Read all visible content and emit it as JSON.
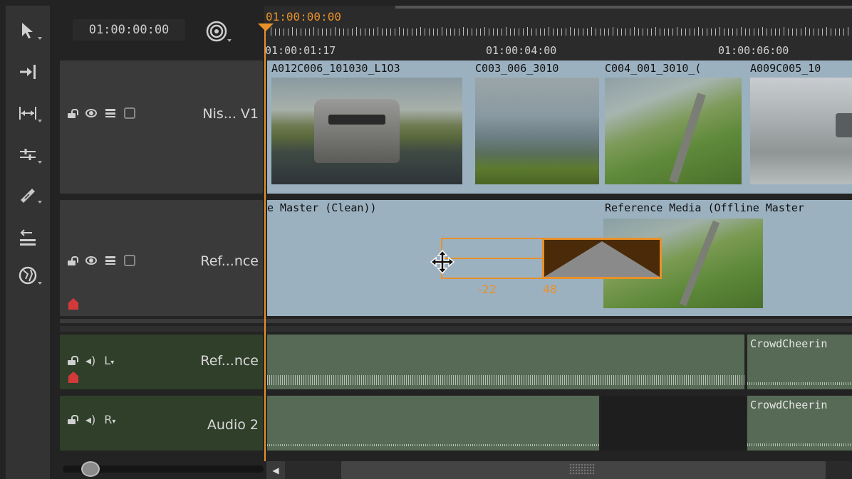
{
  "toolbar": {
    "tools": [
      "select-tool",
      "track-select-tool",
      "slip-tool",
      "razor-tool",
      "multi-tool",
      "nudge-tool",
      "snap-tool"
    ]
  },
  "header": {
    "timecode": "01:00:00:00",
    "snap_icon": "target-icon"
  },
  "ruler": {
    "playhead_time": "01:00:00:00",
    "labels": [
      "01:00:01:17",
      "01:00:04:00",
      "01:00:06:00"
    ]
  },
  "tracks": {
    "video_1": {
      "name": "Nis... V1",
      "clips": [
        {
          "label": "A012C006_101030_L1O3"
        },
        {
          "label": "C003_006_3010"
        },
        {
          "label": "C004_001_3010_("
        },
        {
          "label": "A009C005_10"
        }
      ]
    },
    "video_2": {
      "name": "Ref...nce",
      "clips": [
        {
          "label": "e Master (Clean))"
        },
        {
          "label": "Reference Media (Offline Master"
        }
      ]
    },
    "audio_1": {
      "name": "Ref...nce",
      "channel": "L",
      "clips": [
        {
          "label": ""
        },
        {
          "label": "CrowdCheerin"
        }
      ]
    },
    "audio_2": {
      "name": "Audio 2",
      "channel": "R",
      "clips": [
        {
          "label": ""
        },
        {
          "label": "CrowdCheerin"
        }
      ]
    }
  },
  "transform_overlay": {
    "offset_left": "-22",
    "offset_right": "48"
  },
  "colors": {
    "accent": "#e8912a",
    "video_clip": "#9bb1c0",
    "audio_clip": "#566a55",
    "audio_header": "#2f3f2a"
  }
}
